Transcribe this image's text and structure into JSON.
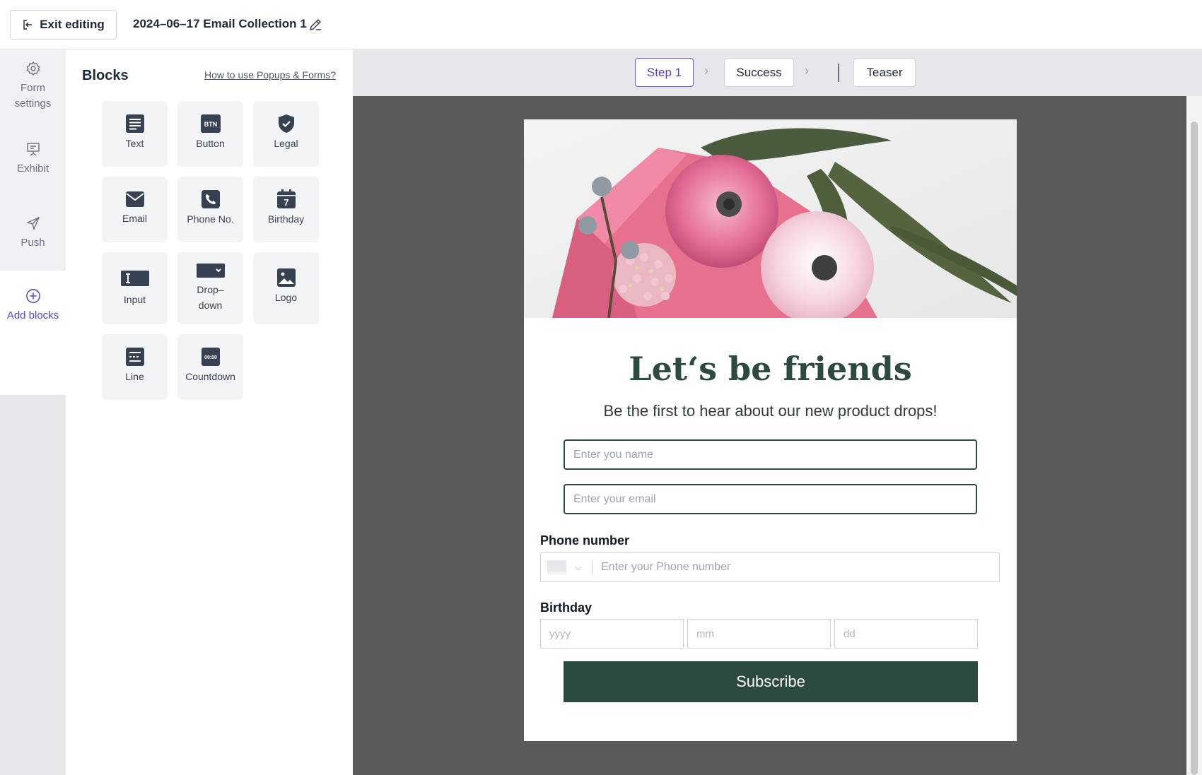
{
  "topbar": {
    "exit_label": "Exit editing",
    "title": "2024–06–17 Email Collection 1"
  },
  "rail": {
    "items": [
      {
        "label": "Form\nsettings",
        "icon": "gear-icon"
      },
      {
        "label": "Exhibit",
        "icon": "presentation-icon"
      },
      {
        "label": "Push",
        "icon": "send-icon"
      },
      {
        "label": "Add blocks",
        "icon": "plus-circle-icon"
      }
    ],
    "active_color": "#5b3fc4"
  },
  "panel": {
    "title": "Blocks",
    "help_link": "How to use Popups & Forms?",
    "blocks": [
      {
        "label": "Text",
        "icon": "text-icon"
      },
      {
        "label": "Button",
        "icon": "button-icon",
        "icon_text": "BTN"
      },
      {
        "label": "Legal",
        "icon": "shield-check-icon"
      },
      {
        "label": "Email",
        "icon": "envelope-icon"
      },
      {
        "label": "Phone No.",
        "icon": "phone-icon"
      },
      {
        "label": "Birthday",
        "icon": "calendar-icon",
        "icon_text": "7"
      },
      {
        "label": "Input",
        "icon": "text-cursor-icon"
      },
      {
        "label": "Drop–\ndown",
        "icon": "dropdown-icon"
      },
      {
        "label": "Logo",
        "icon": "image-icon"
      },
      {
        "label": "Line",
        "icon": "line-icon"
      },
      {
        "label": "Countdown",
        "icon": "countdown-icon",
        "icon_text": "00:00"
      }
    ]
  },
  "steps": {
    "items": [
      "Step 1",
      "Success",
      "Teaser"
    ],
    "active": "Step 1"
  },
  "form": {
    "title": "Let‘s be friends",
    "subtitle": "Be the first to hear about our new product drops!",
    "name_placeholder": "Enter you name",
    "email_placeholder": "Enter your email",
    "phone_label": "Phone number",
    "phone_placeholder": "Enter your Phone number",
    "birthday_label": "Birthday",
    "year_placeholder": "yyyy",
    "month_placeholder": "mm",
    "day_placeholder": "dd",
    "submit_label": "Subscribe",
    "accent": "#2d4a3f"
  }
}
